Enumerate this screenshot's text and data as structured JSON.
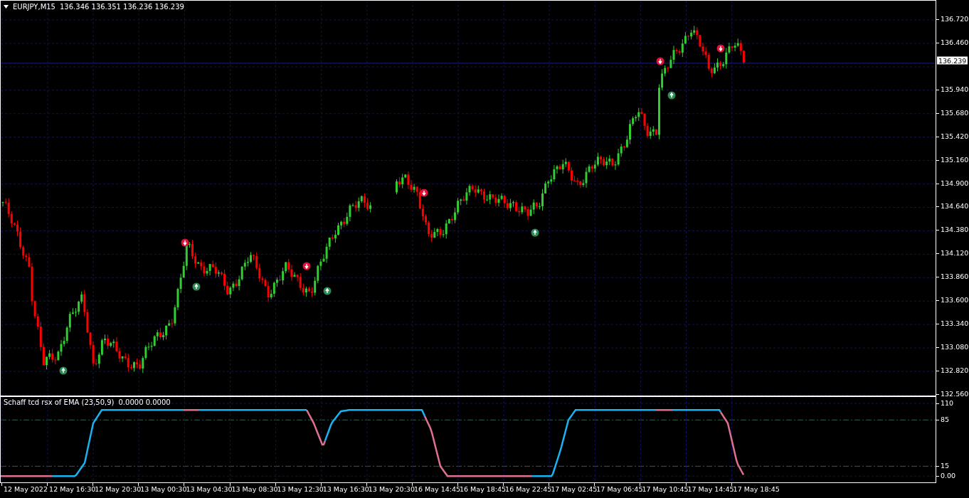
{
  "chart": {
    "symbol": "EURJPY,M15",
    "ohlc": "136.346 136.351 136.236 136.239",
    "current_price": "136.239",
    "price_ticks": [
      "136.720",
      "136.460",
      "135.940",
      "135.680",
      "135.420",
      "135.160",
      "134.900",
      "134.640",
      "134.380",
      "134.120",
      "133.860",
      "133.600",
      "133.340",
      "133.080",
      "132.820",
      "132.560"
    ]
  },
  "indicator": {
    "label": "Schaff tcd rsx of EMA (23,50,9)",
    "values": "0.0000 0.0000",
    "levels": [
      "110",
      "85",
      "15",
      "0.00"
    ]
  },
  "time_axis": [
    "12 May 2022",
    "12 May 16:30",
    "12 May 20:30",
    "13 May 00:30",
    "13 May 04:30",
    "13 May 08:30",
    "13 May 12:30",
    "13 May 16:30",
    "13 May 20:30",
    "16 May 14:45",
    "16 May 18:45",
    "16 May 22:45",
    "17 May 02:45",
    "17 May 06:45",
    "17 May 10:45",
    "17 May 14:45",
    "17 May 18:45"
  ]
}
